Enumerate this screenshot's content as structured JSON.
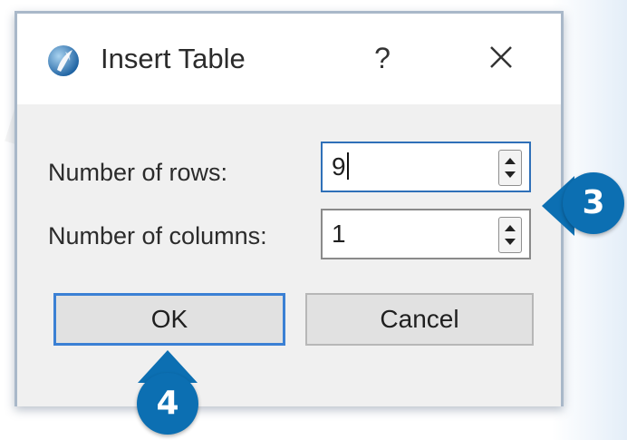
{
  "dialog": {
    "title": "Insert Table",
    "help_label": "?",
    "icon": "app-logo-icon",
    "close_icon": "close-icon"
  },
  "fields": {
    "rows_label": "Number of rows:",
    "rows_value": "9",
    "columns_label": "Number of columns:",
    "columns_value": "1"
  },
  "buttons": {
    "ok": "OK",
    "cancel": "Cancel"
  },
  "callouts": {
    "fields_step": "3",
    "ok_step": "4"
  },
  "colors": {
    "callout": "#0c6fb2",
    "focus_border": "#2f70b8"
  }
}
